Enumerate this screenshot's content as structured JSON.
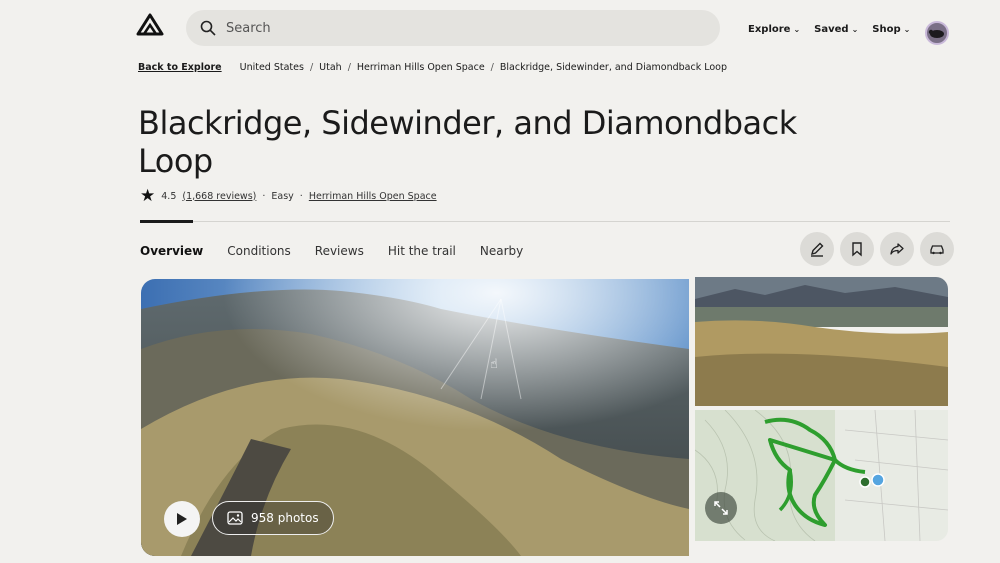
{
  "header": {
    "logo": "mountain-logo",
    "search_placeholder": "Search",
    "nav": [
      {
        "label": "Explore"
      },
      {
        "label": "Saved"
      },
      {
        "label": "Shop"
      }
    ]
  },
  "breadcrumb": {
    "back": "Back to Explore",
    "items": [
      "United States",
      "Utah",
      "Herriman Hills Open Space",
      "Blackridge, Sidewinder, and Diamondback Loop"
    ],
    "separator": "/"
  },
  "trail": {
    "title": "Blackridge, Sidewinder, and Diamondback Loop",
    "rating": "4.5",
    "reviews": "(1,668 reviews)",
    "dot": "·",
    "difficulty": "Easy",
    "park": "Herriman Hills Open Space"
  },
  "tabs": [
    {
      "label": "Overview",
      "active": true
    },
    {
      "label": "Conditions"
    },
    {
      "label": "Reviews"
    },
    {
      "label": "Hit the trail"
    },
    {
      "label": "Nearby"
    }
  ],
  "actions": [
    "edit-icon",
    "bookmark-icon",
    "share-icon",
    "car-icon"
  ],
  "media": {
    "photos_label": "958 photos"
  },
  "colors": {
    "accent": "#1b1b1b",
    "trail_green": "#2e9e2e",
    "background": "#f2f1ee"
  }
}
